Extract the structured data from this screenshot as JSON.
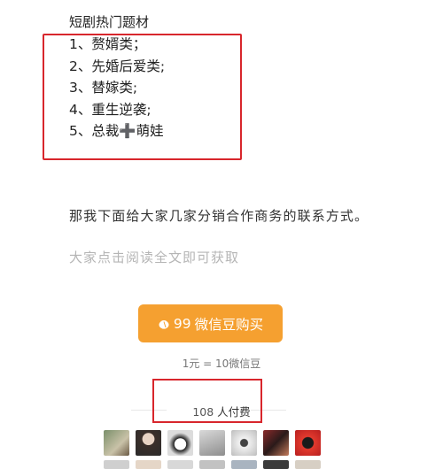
{
  "list_title": "短剧热门题材",
  "items": [
    "1、赘婿类；",
    "2、先婚后爱类;",
    "3、替嫁类;",
    "4、重生逆袭;",
    "5、总裁➕萌娃"
  ],
  "paragraph": "那我下面给大家几家分销合作商务的联系方式。",
  "hint": "大家点击阅读全文即可获取",
  "buy_button": {
    "amount": "99",
    "label": "微信豆购买"
  },
  "rate": "1元 = 10微信豆",
  "payers": {
    "count": "108",
    "suffix": "人付费"
  },
  "colors": {
    "accent": "#f5a030",
    "highlight_box": "#d8262c"
  },
  "avatar_count": 7
}
